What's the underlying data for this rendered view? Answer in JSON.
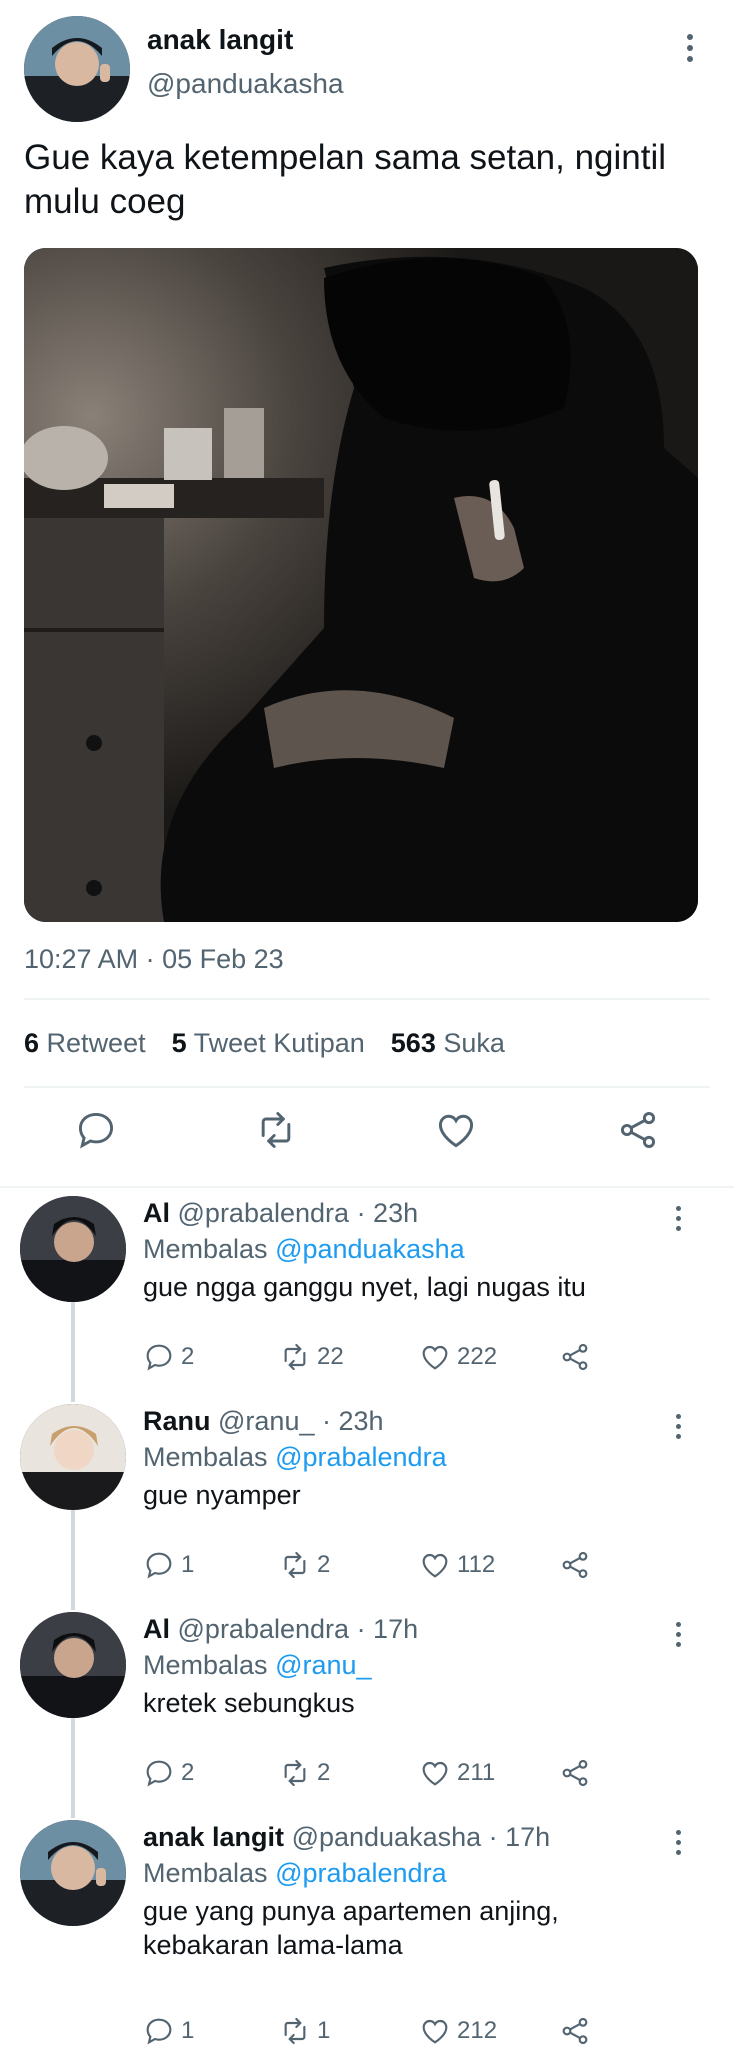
{
  "main_tweet": {
    "author_name": "anak langit",
    "author_handle": "@panduakasha",
    "text": "Gue kaya ketempelan sama setan, ngintil mulu coeg",
    "timestamp": "10:27 AM · 05 Feb 23",
    "stats": {
      "retweets_count": "6",
      "retweets_label": "Retweet",
      "quotes_count": "5",
      "quotes_label": "Tweet Kutipan",
      "likes_count": "563",
      "likes_label": "Suka"
    },
    "actions": [
      "reply-icon",
      "retweet-icon",
      "like-icon",
      "share-icon"
    ]
  },
  "replies": [
    {
      "name": "Al",
      "handle": "@prabalendra",
      "time": "· 23h",
      "replying_label": "Membalas",
      "replying_to": "@panduakasha",
      "text": "gue ngga ganggu nyet, lagi nugas itu",
      "replies": "2",
      "retweets": "22",
      "likes": "222"
    },
    {
      "name": "Ranu",
      "handle": "@ranu_",
      "time": "· 23h",
      "replying_label": "Membalas",
      "replying_to": "@prabalendra",
      "text": "gue nyamper",
      "replies": "1",
      "retweets": "2",
      "likes": "112"
    },
    {
      "name": "Al",
      "handle": "@prabalendra",
      "time": "· 17h",
      "replying_label": "Membalas",
      "replying_to": "@ranu_",
      "text": "kretek sebungkus",
      "replies": "2",
      "retweets": "2",
      "likes": "211"
    },
    {
      "name": "anak langit",
      "handle": "@panduakasha",
      "time": "· 17h",
      "replying_label": "Membalas",
      "replying_to": "@prabalendra",
      "text": "gue yang punya apartemen anjing, kebakaran lama-lama",
      "replies": "1",
      "retweets": "1",
      "likes": "212"
    }
  ],
  "colors": {
    "accent": "#1d9bf0",
    "secondary_text": "#536471",
    "primary_text": "#0f1419",
    "divider": "#eff3f4"
  }
}
